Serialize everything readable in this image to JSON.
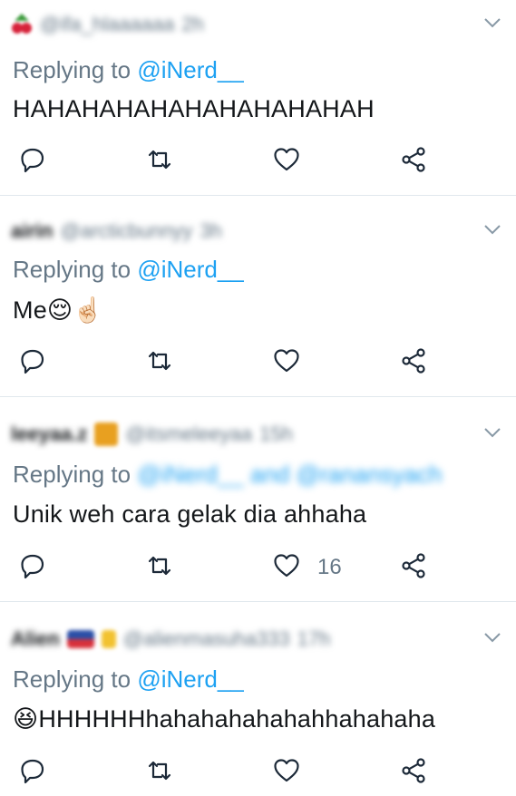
{
  "tweets": [
    {
      "name": "",
      "handle": "@ifa_hlaaaaaa",
      "time": "2h",
      "reply_prefix": "Replying to",
      "reply_to": "@iNerd__",
      "text": "HAHAHAHAHAHAHAHAHAHAH",
      "likes": ""
    },
    {
      "name": "airin",
      "handle": "@arcticbunnyy",
      "time": "3h",
      "reply_prefix": "Replying to",
      "reply_to": "@iNerd__",
      "text": "Me😌☝🏻",
      "likes": ""
    },
    {
      "name": "leeyaa.z",
      "handle": "@itsmeleeyaa",
      "time": "15h",
      "reply_prefix": "Replying to",
      "reply_to": "@iNerd__ and @ranansyach",
      "text": "Unik weh cara gelak dia ahhaha",
      "likes": "16"
    },
    {
      "name": "Alien",
      "handle": "@alienmasuha333",
      "time": "17h",
      "reply_prefix": "Replying to",
      "reply_to": "@iNerd__",
      "text": "😆HHHHHHhahahahahahahhahahaha",
      "likes": ""
    }
  ],
  "colors": {
    "accent": "#1da1f2",
    "muted": "#657786",
    "text": "#14171a",
    "divider": "#e1e8ed"
  },
  "icons": [
    "reply-icon",
    "retweet-icon",
    "like-icon",
    "share-icon",
    "caret-down-icon"
  ]
}
